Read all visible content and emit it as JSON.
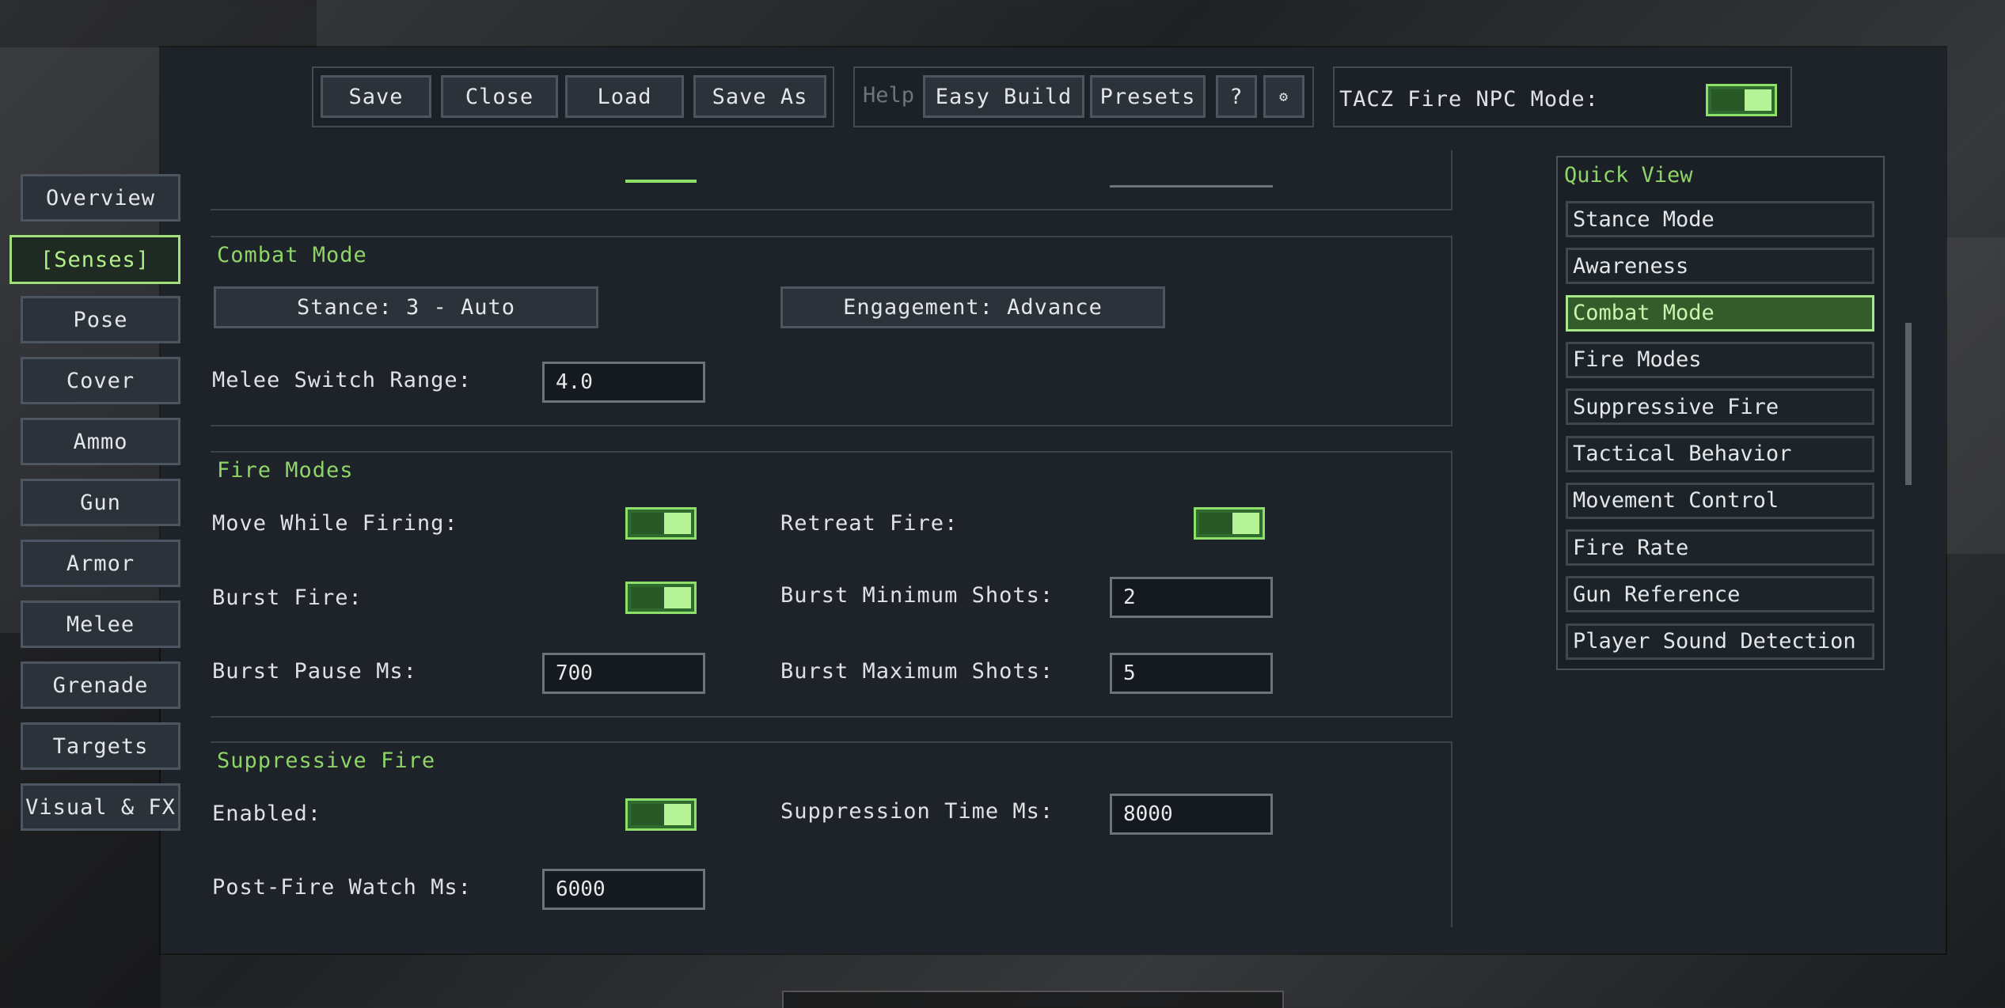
{
  "toolbar": {
    "save": "Save",
    "close": "Close",
    "load": "Load",
    "save_as": "Save As",
    "help_label": "Help",
    "easy_build": "Easy Build",
    "presets": "Presets",
    "question": "?",
    "gear": "⚙",
    "tacz_label": "TACZ Fire NPC Mode:",
    "tacz_enabled": true
  },
  "sidebar": {
    "items": [
      {
        "label": "Overview",
        "active": false
      },
      {
        "label": "[Senses]",
        "active": true
      },
      {
        "label": "Pose",
        "active": false
      },
      {
        "label": "Cover",
        "active": false
      },
      {
        "label": "Ammo",
        "active": false
      },
      {
        "label": "Gun",
        "active": false
      },
      {
        "label": "Armor",
        "active": false
      },
      {
        "label": "Melee",
        "active": false
      },
      {
        "label": "Grenade",
        "active": false
      },
      {
        "label": "Targets",
        "active": false
      },
      {
        "label": "Visual & FX",
        "active": false
      }
    ]
  },
  "combat_mode": {
    "title": "Combat Mode",
    "stance_button": "Stance: 3 - Auto",
    "engagement_button": "Engagement: Advance",
    "melee_switch_label": "Melee Switch Range:",
    "melee_switch_value": "4.0"
  },
  "fire_modes": {
    "title": "Fire Modes",
    "move_while_firing_label": "Move While Firing:",
    "move_while_firing": true,
    "retreat_fire_label": "Retreat Fire:",
    "retreat_fire": true,
    "burst_fire_label": "Burst Fire:",
    "burst_fire": true,
    "burst_min_label": "Burst Minimum Shots:",
    "burst_min_value": "2",
    "burst_pause_label": "Burst Pause Ms:",
    "burst_pause_value": "700",
    "burst_max_label": "Burst Maximum Shots:",
    "burst_max_value": "5"
  },
  "suppressive_fire": {
    "title": "Suppressive Fire",
    "enabled_label": "Enabled:",
    "enabled": true,
    "suppression_time_label": "Suppression Time Ms:",
    "suppression_time_value": "8000",
    "post_fire_label": "Post-Fire Watch Ms:",
    "post_fire_value": "6000"
  },
  "quick_view": {
    "title": "Quick View",
    "items": [
      {
        "label": "Stance Mode",
        "active": false
      },
      {
        "label": "Awareness",
        "active": false
      },
      {
        "label": "Combat Mode",
        "active": true
      },
      {
        "label": "Fire Modes",
        "active": false
      },
      {
        "label": "Suppressive Fire",
        "active": false
      },
      {
        "label": "Tactical Behavior",
        "active": false
      },
      {
        "label": "Movement Control",
        "active": false
      },
      {
        "label": "Fire Rate",
        "active": false
      },
      {
        "label": "Gun Reference",
        "active": false
      },
      {
        "label": "Player Sound Detection",
        "active": false
      }
    ]
  },
  "colors": {
    "accent": "#8fd468",
    "panel": "#1d2329",
    "toggle_on": "#2f6b2e"
  }
}
